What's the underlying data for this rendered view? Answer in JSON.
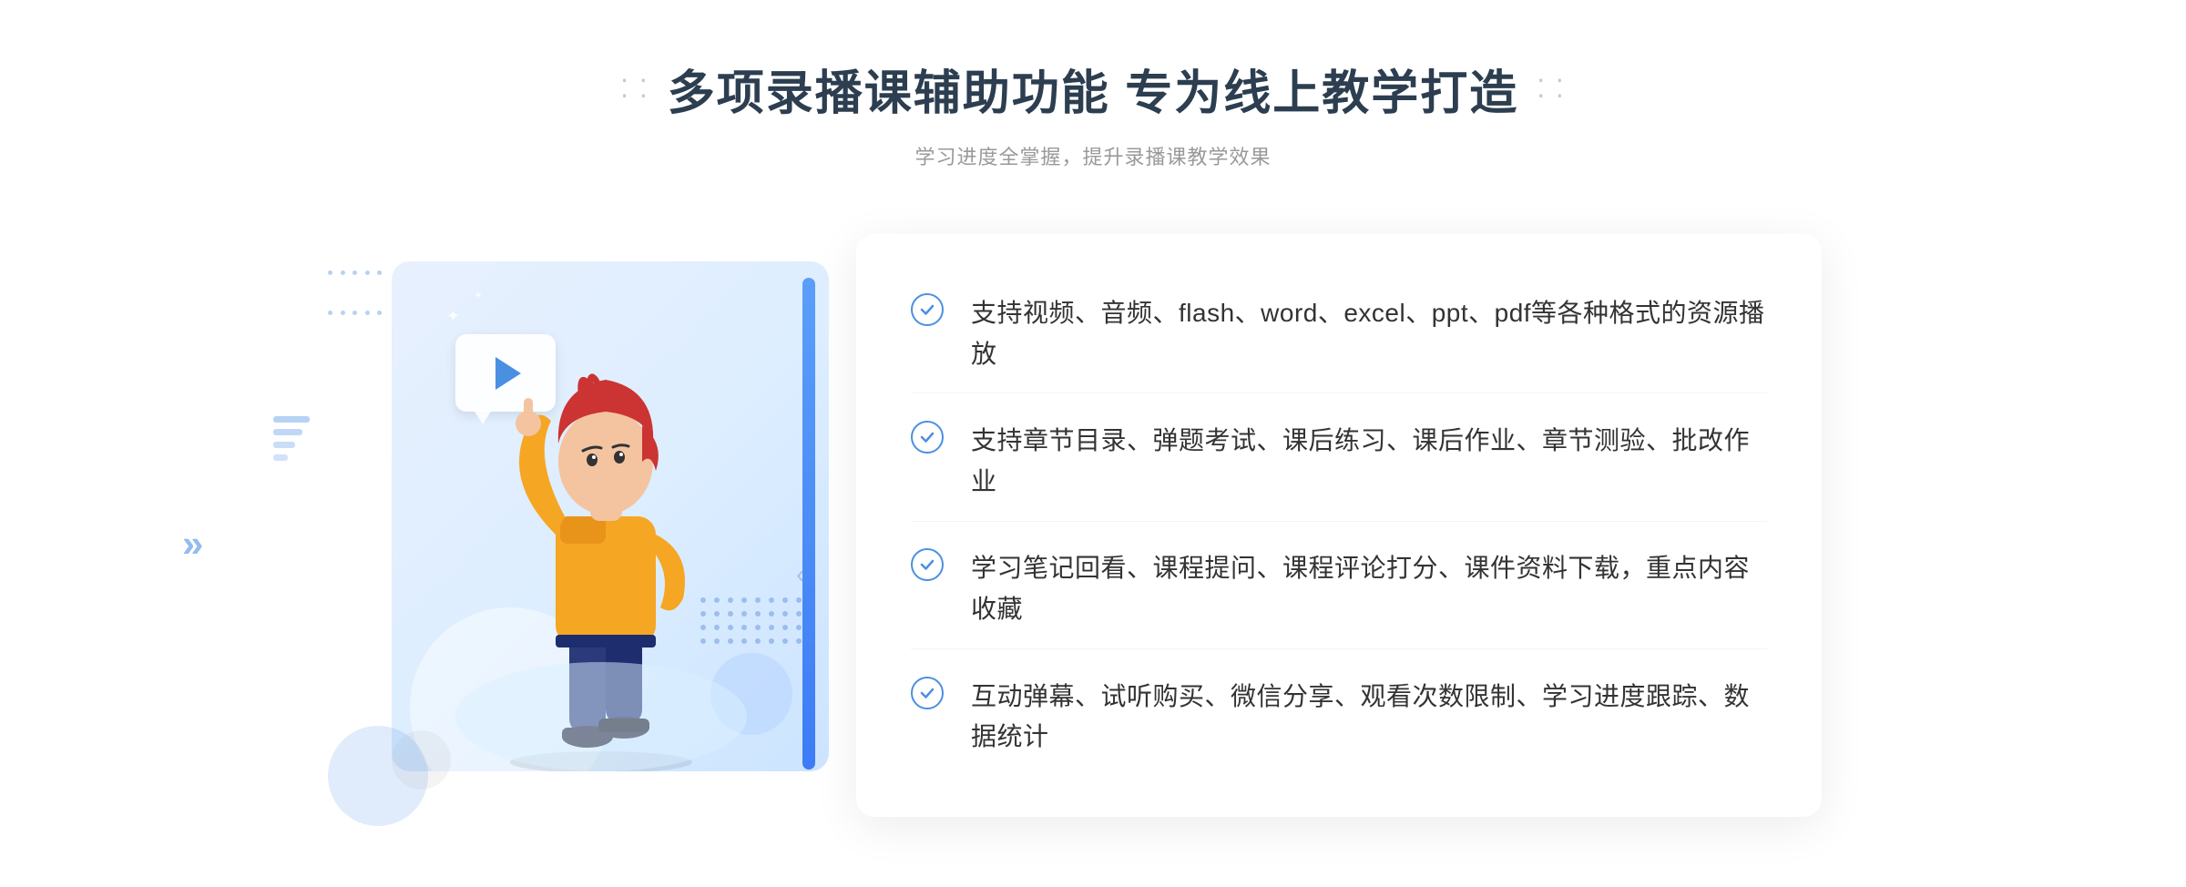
{
  "page": {
    "background_color": "#ffffff"
  },
  "header": {
    "main_title": "多项录播课辅助功能 专为线上教学打造",
    "subtitle": "学习进度全掌握，提升录播课教学效果",
    "decorator_left": "❖",
    "decorator_right": "❖"
  },
  "features": [
    {
      "id": 1,
      "text": "支持视频、音频、flash、word、excel、ppt、pdf等各种格式的资源播放"
    },
    {
      "id": 2,
      "text": "支持章节目录、弹题考试、课后练习、课后作业、章节测验、批改作业"
    },
    {
      "id": 3,
      "text": "学习笔记回看、课程提问、课程评论打分、课件资料下载，重点内容收藏"
    },
    {
      "id": 4,
      "text": "互动弹幕、试听购买、微信分享、观看次数限制、学习进度跟踪、数据统计"
    }
  ],
  "illustration": {
    "play_icon": "▶",
    "chevron": "»"
  },
  "colors": {
    "primary_blue": "#4a90e2",
    "light_blue": "#5b9ef8",
    "dark_text": "#2c3e50",
    "medium_text": "#333333",
    "light_text": "#999999",
    "bg_light": "#f8faff"
  }
}
